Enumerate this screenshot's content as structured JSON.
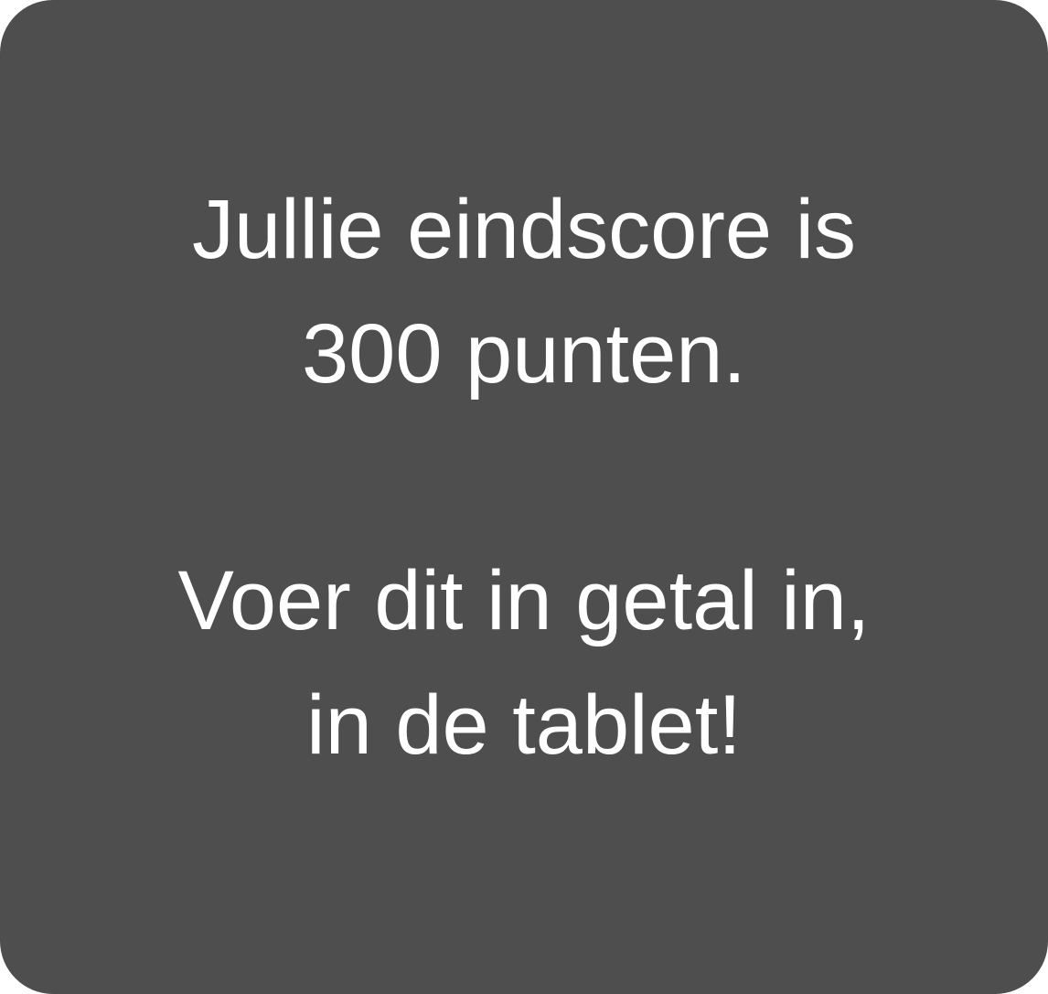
{
  "message": {
    "score_lines": [
      "Jullie eindscore is",
      "300 punten."
    ],
    "instruction_lines": [
      "Voer dit in getal in,",
      "in de tablet!"
    ]
  },
  "colors": {
    "card_background": "#4e4e4e",
    "text": "#ffffff"
  }
}
